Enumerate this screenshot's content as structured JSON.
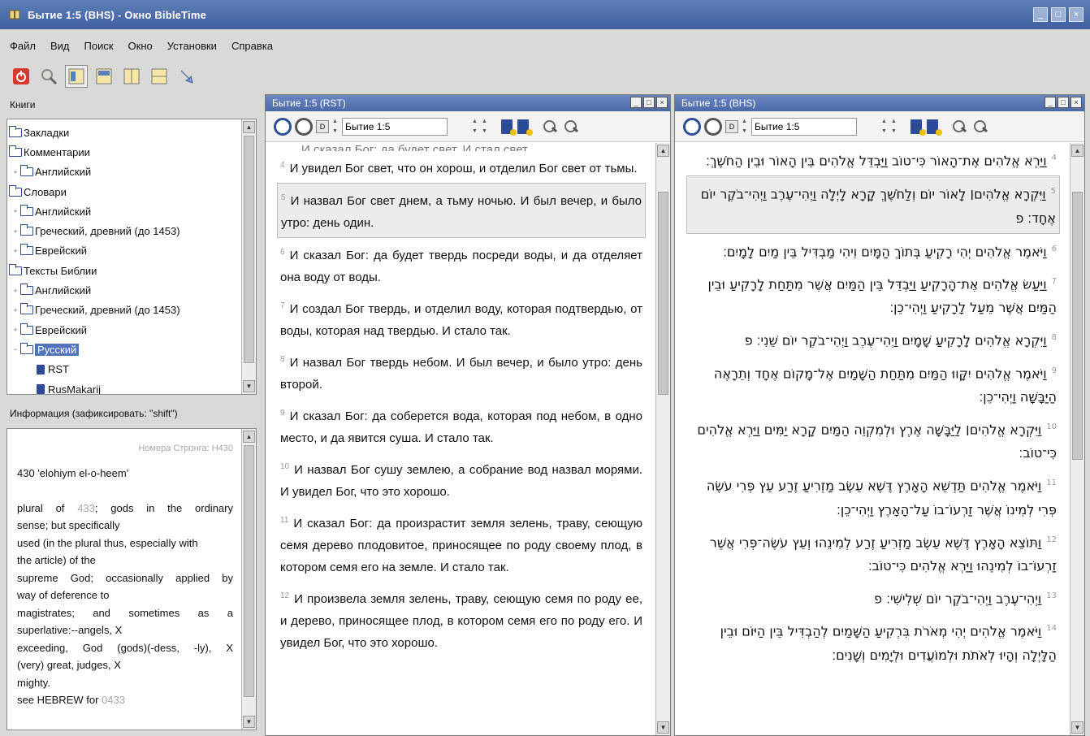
{
  "window": {
    "title": "Бытие 1:5 (BHS) - Окно BibleTime"
  },
  "menu": [
    "Файл",
    "Вид",
    "Поиск",
    "Окно",
    "Установки",
    "Справка"
  ],
  "left": {
    "books_label": "Книги",
    "tree": [
      {
        "label": "Закладки",
        "indent": 0,
        "exp": "",
        "type": "folder"
      },
      {
        "label": "Комментарии",
        "indent": 0,
        "exp": "",
        "type": "folder"
      },
      {
        "label": "Английский",
        "indent": 1,
        "exp": "+",
        "type": "folder"
      },
      {
        "label": "Словари",
        "indent": 0,
        "exp": "",
        "type": "folder"
      },
      {
        "label": "Английский",
        "indent": 1,
        "exp": "+",
        "type": "folder"
      },
      {
        "label": "Греческий, древний (до 1453)",
        "indent": 1,
        "exp": "+",
        "type": "folder"
      },
      {
        "label": "Еврейский",
        "indent": 1,
        "exp": "+",
        "type": "folder"
      },
      {
        "label": "Тексты Библии",
        "indent": 0,
        "exp": "",
        "type": "folder"
      },
      {
        "label": "Английский",
        "indent": 1,
        "exp": "+",
        "type": "folder"
      },
      {
        "label": "Греческий, древний (до 1453)",
        "indent": 1,
        "exp": "+",
        "type": "folder"
      },
      {
        "label": "Еврейский",
        "indent": 1,
        "exp": "+",
        "type": "folder"
      },
      {
        "label": "Русский",
        "indent": 1,
        "exp": "-",
        "type": "folder",
        "selected": true
      },
      {
        "label": "RST",
        "indent": 2,
        "exp": "",
        "type": "book"
      },
      {
        "label": "RusMakarij",
        "indent": 2,
        "exp": "",
        "type": "book"
      }
    ],
    "info_label": "Информация (зафиксировать: \"shift\")",
    "info": {
      "header": "Номера Стронга: H430",
      "lines": [
        {
          "text": "430 'elohiym el-o-heem'",
          "justify": false
        },
        {
          "text": "",
          "justify": false
        },
        {
          "text": "plural of 433; gods in the ordinary",
          "justify": true
        },
        {
          "text": "sense; but specifically",
          "justify": false
        },
        {
          "text": "used (in the plural thus, especially with",
          "justify": false
        },
        {
          "text": "the article) of the",
          "justify": false
        },
        {
          "text": "supreme God; occasionally applied by",
          "justify": true
        },
        {
          "text": "way of deference to",
          "justify": false
        },
        {
          "text": "magistrates; and sometimes as a",
          "justify": true
        },
        {
          "text": "superlative:--angels, X",
          "justify": false
        },
        {
          "text": "exceeding, God (gods)(-dess, -ly), X",
          "justify": true
        },
        {
          "text": "(very) great, judges, X",
          "justify": false
        },
        {
          "text": "mighty.",
          "justify": false
        },
        {
          "text": "see HEBREW for 0433",
          "justify": false
        }
      ]
    }
  },
  "panes": {
    "rst": {
      "title": "Бытие 1:5 (RST)",
      "key": "Бытие 1:5",
      "cutoff": "И сказал Бог: да будет свет. И стал свет.",
      "verses": [
        {
          "n": "4",
          "text": "И увидел Бог свет, что он хорош, и отделил Бог свет от тьмы."
        },
        {
          "n": "5",
          "text": "И назвал Бог свет днем, а тьму ночью. И был вечер, и было утро: день один.",
          "hl": true
        },
        {
          "n": "6",
          "text": "И сказал Бог: да будет твердь посреди воды, и да отделяет она воду от воды."
        },
        {
          "n": "7",
          "text": "И создал Бог твердь, и отделил воду, которая подтвердью, от воды, которая над твердью. И стало так."
        },
        {
          "n": "8",
          "text": "И назвал Бог твердь небом. И был вечер, и было утро: день второй."
        },
        {
          "n": "9",
          "text": "И сказал Бог: да соберется вода, которая под небом, в одно место, и да явится суша. И стало так."
        },
        {
          "n": "10",
          "text": "И назвал Бог сушу землею, а собрание вод назвал морями. И увидел Бог, что это хорошо."
        },
        {
          "n": "11",
          "text": "И сказал Бог: да произрастит земля зелень, траву, сеющую семя дерево плодовитое, приносящее по роду своему плод, в котором семя его на земле. И стало так."
        },
        {
          "n": "12",
          "text": "И произвела земля зелень, траву, сеющую семя по роду ее, и дерево, приносящее плод, в котором семя его по роду его. И увидел Бог, что это хорошо."
        }
      ]
    },
    "bhs": {
      "title": "Бытие 1:5 (BHS)",
      "key": "Бытие 1:5",
      "verses": [
        {
          "n": "4",
          "text": "וַיַּרְא אֱלֹהִים אֶת־הָאוֹר כִּי־טוֹב וַיַּבְדֵּל אֱלֹהִים בֵּין הָאוֹר וּבֵין הַחֹשֶׁךְ׃"
        },
        {
          "n": "5",
          "text": "וַיִּקְרָא אֱלֹהִים׀ לָאוֹר יוֹם וְלַחֹשֶׁךְ קָרָא לָיְלָה וַיְהִי־עֶרֶב וַיְהִי־בֹקֶר יוֹם אֶחָד׃ פ",
          "hl": true
        },
        {
          "n": "6",
          "text": "וַיֹּאמֶר אֱלֹהִים יְהִי רָקִיעַ בְּתוֹךְ הַמָּיִם וִיהִי מַבְדִּיל בֵּין מַיִם לָמָיִם׃"
        },
        {
          "n": "7",
          "text": "וַיַּעַשׂ אֱלֹהִים אֶת־הָרָקִיעַ וַיַּבְדֵּל בֵּין הַמַּיִם אֲשֶׁר מִתַּחַת לָרָקִיעַ וּבֵין הַמַּיִם אֲשֶׁר מֵעַל לָרָקִיעַ וַיְהִי־כֵן׃"
        },
        {
          "n": "8",
          "text": "וַיִּקְרָא אֱלֹהִים לָרָקִיעַ שָׁמָיִם וַיְהִי־עֶרֶב וַיְהִי־בֹקֶר יוֹם שֵׁנִי׃ פ"
        },
        {
          "n": "9",
          "text": "וַיֹּאמֶר אֱלֹהִים יִקָּווּ הַמַּיִם מִתַּחַת הַשָּׁמַיִם אֶל־מָקוֹם אֶחָד וְתֵרָאֶה הַיַּבָּשָׁה וַיְהִי־כֵן׃"
        },
        {
          "n": "10",
          "text": "וַיִּקְרָא אֱלֹהִים׀ לַיַּבָּשָׁה אֶרֶץ וּלְמִקְוֵה הַמַּיִם קָרָא יַמִּים וַיַּרְא אֱלֹהִים כִּי־טוֹב׃"
        },
        {
          "n": "11",
          "text": "וַיֹּאמֶר אֱלֹהִים תַּדְשֵׁא הָאָרֶץ דֶּשֶׁא עֵשֶׂב מַזְרִיעַ זֶרַע עֵץ פְּרִי עֹשֶׂה פְּרִי לְמִינוֹ אֲשֶׁר זַרְעוֹ־בוֹ עַל־הָאָרֶץ וַיְהִי־כֵן׃"
        },
        {
          "n": "12",
          "text": "וַתּוֹצֵא הָאָרֶץ דֶּשֶׁא עֵשֶׂב מַזְרִיעַ זֶרַע לְמִינֵהוּ וְעֵץ עֹשֶׂה־פְּרִי אֲשֶׁר זַרְעוֹ־בוֹ לְמִינֵהוּ וַיַּרְא אֱלֹהִים כִּי־טוֹב׃"
        },
        {
          "n": "13",
          "text": "וַיְהִי־עֶרֶב וַיְהִי־בֹקֶר יוֹם שְׁלִישִׁי׃ פ"
        },
        {
          "n": "14",
          "text": "וַיֹּאמֶר אֱלֹהִים יְהִי מְאֹרֹת בִּרְקִיעַ הַשָּׁמַיִם לְהַבְדִּיל בֵּין הַיּוֹם וּבֵין הַלָּיְלָה וְהָיוּ לְאֹתֹת וּלְמוֹעֲדִים וּלְיָמִים וְשָׁנִים׃"
        }
      ]
    }
  }
}
